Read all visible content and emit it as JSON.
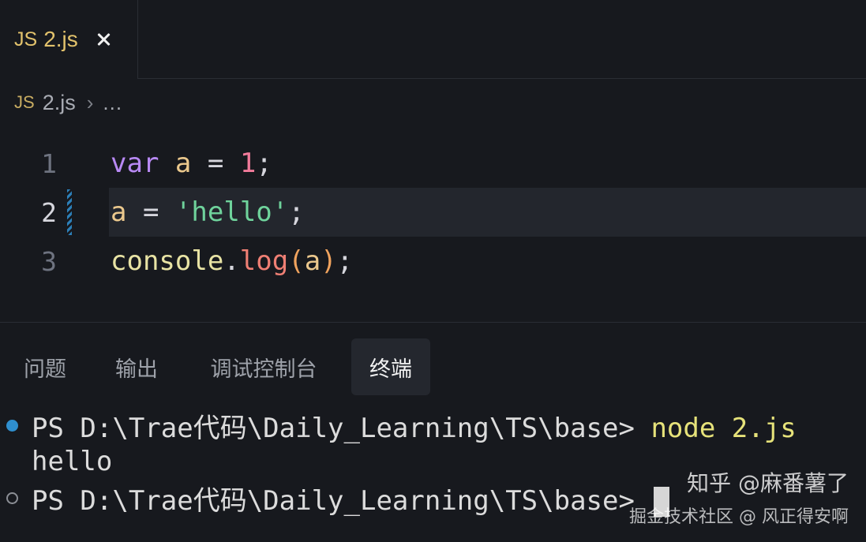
{
  "tab": {
    "icon": "JS",
    "label": "2.js",
    "close_icon": "close-icon"
  },
  "breadcrumb": {
    "icon": "JS",
    "file": "2.js",
    "separator": "›",
    "more": "..."
  },
  "editor": {
    "lines": [
      {
        "number": "1",
        "tokens": {
          "kw": "var",
          "v": "a",
          "op": "=",
          "num": "1",
          "end": ";"
        }
      },
      {
        "number": "2",
        "tokens": {
          "v": "a",
          "op": "=",
          "str": "'hello'",
          "end": ";"
        }
      },
      {
        "number": "3",
        "tokens": {
          "obj": "console",
          "dot": ".",
          "fn": "log",
          "lp": "(",
          "arg": "a",
          "rp": ")",
          "end": ";"
        }
      }
    ],
    "active_line": 2
  },
  "panel": {
    "tabs": [
      "问题",
      "输出",
      "调试控制台",
      "终端"
    ],
    "active_tab": "终端"
  },
  "terminal": {
    "lines": [
      {
        "prompt": "PS D:\\Trae代码\\Daily_Learning\\TS\\base> ",
        "command": "node 2.js",
        "marker": "success"
      },
      {
        "output": "hello"
      },
      {
        "prompt": "PS D:\\Trae代码\\Daily_Learning\\TS\\base> ",
        "marker": "idle"
      }
    ]
  },
  "watermark": {
    "line1": "知乎 @麻番薯了",
    "line2": "掘金技术社区 @ 风正得安啊"
  },
  "colors": {
    "background": "#17191e",
    "active_line": "#23262d",
    "keyword": "#b889f4",
    "string": "#6fd39c",
    "number": "#f27b9b",
    "function": "#ef7f74",
    "command": "#e6e27a",
    "terminal_success_dot": "#2f8fcf"
  }
}
